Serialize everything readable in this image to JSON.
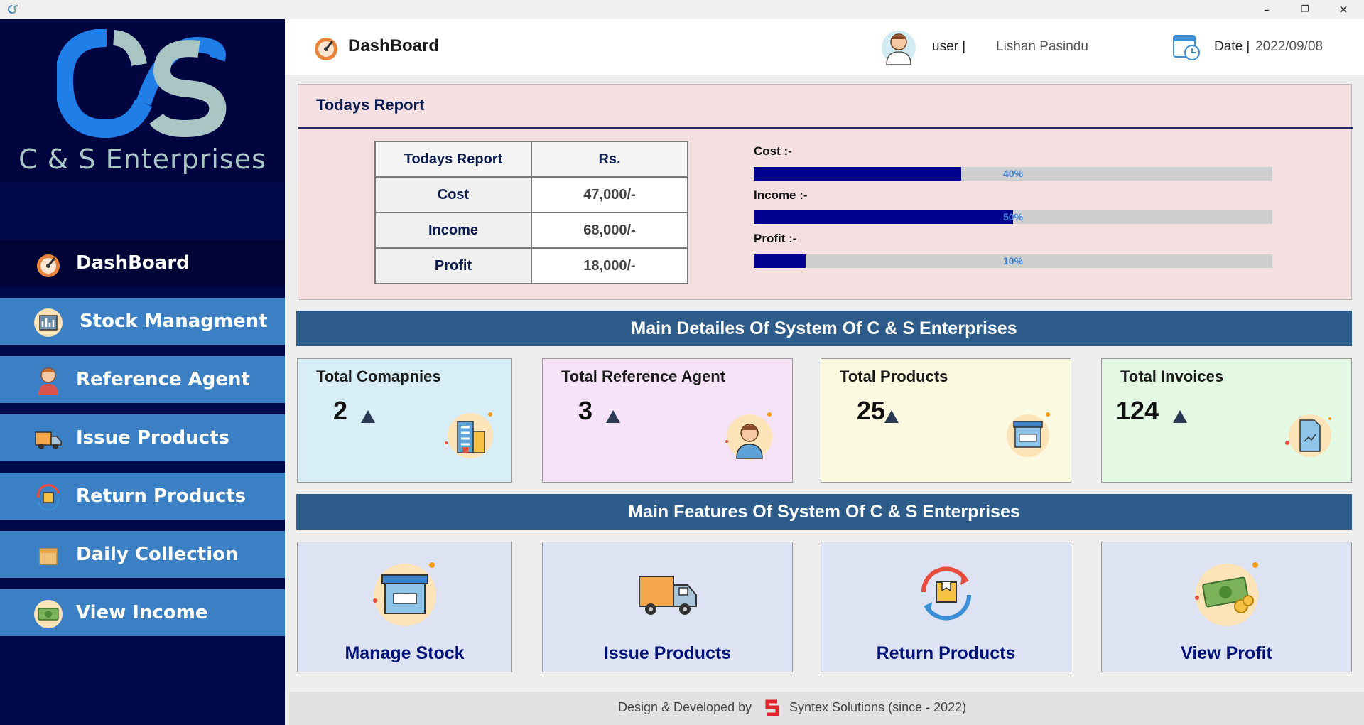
{
  "window": {
    "minimize": "–",
    "restore": "❐",
    "close": "✕"
  },
  "sidebar": {
    "brand": "C & S Enterprises",
    "items": [
      {
        "label": "DashBoard",
        "icon": "dashboard-gauge-icon",
        "active": true
      },
      {
        "label": "Stock Managment",
        "icon": "stock-chart-icon"
      },
      {
        "label": "Reference Agent",
        "icon": "agent-person-icon"
      },
      {
        "label": "Issue Products",
        "icon": "truck-icon"
      },
      {
        "label": "Return Products",
        "icon": "return-box-icon"
      },
      {
        "label": "Daily Collection",
        "icon": "box-icon"
      },
      {
        "label": "View Income",
        "icon": "money-icon"
      }
    ]
  },
  "header": {
    "title": "DashBoard",
    "user_label": "user |",
    "user_name": "Lishan Pasindu",
    "date_label": "Date |",
    "date_value": "2022/09/08"
  },
  "report": {
    "title": "Todays Report",
    "table": {
      "headers": [
        "Todays Report",
        "Rs."
      ],
      "rows": [
        {
          "label": "Cost",
          "value": "47,000/-"
        },
        {
          "label": "Income",
          "value": "68,000/-"
        },
        {
          "label": "Profit",
          "value": "18,000/-"
        }
      ]
    },
    "bars": [
      {
        "label": "Cost :-",
        "percent": 40,
        "text": "40%"
      },
      {
        "label": "Income :-",
        "percent": 50,
        "text": "50%"
      },
      {
        "label": "Profit :-",
        "percent": 10,
        "text": "10%"
      }
    ]
  },
  "details": {
    "heading": "Main Detailes Of System Of C & S Enterprises",
    "cards": [
      {
        "title": "Total Comapnies",
        "value": "2",
        "icon": "building-icon",
        "bg": "#d7eef6"
      },
      {
        "title": "Total Reference Agent",
        "value": "3",
        "icon": "agent-icon",
        "bg": "#f6e2f6"
      },
      {
        "title": "Total Products",
        "value": "25",
        "icon": "product-box-icon",
        "bg": "#fbf9df"
      },
      {
        "title": "Total Invoices",
        "value": "124",
        "icon": "invoice-icon",
        "bg": "#e4f9e4"
      }
    ]
  },
  "features": {
    "heading": "Main Features Of System Of C & S Enterprises",
    "items": [
      {
        "label": "Manage Stock",
        "icon": "manage-stock-icon"
      },
      {
        "label": "Issue Products",
        "icon": "delivery-truck-icon"
      },
      {
        "label": "Return Products",
        "icon": "return-products-icon"
      },
      {
        "label": "View Profit",
        "icon": "profit-money-icon"
      }
    ]
  },
  "footer": {
    "credit": "Design & Developed by",
    "company": "Syntex Solutions (since - 2022)"
  },
  "colors": {
    "sidebar_bg": "#000a4a",
    "nav_item": "#3b7fc4",
    "section_bar": "#2e5c8a",
    "progress_fill": "#00008f",
    "report_bg": "#f5e0e1"
  }
}
